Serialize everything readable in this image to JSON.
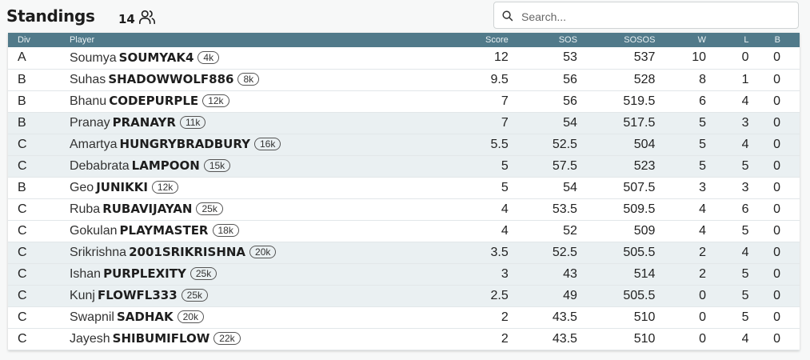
{
  "header": {
    "title": "Standings",
    "participant_count": "14",
    "people_icon": "people-icon"
  },
  "search": {
    "placeholder": "Search...",
    "icon": "search-icon"
  },
  "table": {
    "columns": {
      "div": "Div",
      "player": "Player",
      "score": "Score",
      "sos": "SOS",
      "sosos": "SOSOS",
      "w": "W",
      "l": "L",
      "b": "B"
    },
    "rows": [
      {
        "div": "A",
        "name": "Soumya",
        "handle": "SOUMYAK4",
        "rank": "4k",
        "score": "12",
        "sos": "53",
        "sosos": "537",
        "w": "10",
        "l": "0",
        "b": "0",
        "shaded": false
      },
      {
        "div": "B",
        "name": "Suhas",
        "handle": "SHADOWWOLF886",
        "rank": "8k",
        "score": "9.5",
        "sos": "56",
        "sosos": "528",
        "w": "8",
        "l": "1",
        "b": "0",
        "shaded": false
      },
      {
        "div": "B",
        "name": "Bhanu",
        "handle": "CODEPURPLE",
        "rank": "12k",
        "score": "7",
        "sos": "56",
        "sosos": "519.5",
        "w": "6",
        "l": "4",
        "b": "0",
        "shaded": false
      },
      {
        "div": "B",
        "name": "Pranay",
        "handle": "PRANAYR",
        "rank": "11k",
        "score": "7",
        "sos": "54",
        "sosos": "517.5",
        "w": "5",
        "l": "3",
        "b": "0",
        "shaded": true
      },
      {
        "div": "C",
        "name": "Amartya",
        "handle": "HUNGRYBRADBURY",
        "rank": "16k",
        "score": "5.5",
        "sos": "52.5",
        "sosos": "504",
        "w": "5",
        "l": "4",
        "b": "0",
        "shaded": true
      },
      {
        "div": "C",
        "name": "Debabrata",
        "handle": "LAMPOON",
        "rank": "15k",
        "score": "5",
        "sos": "57.5",
        "sosos": "523",
        "w": "5",
        "l": "5",
        "b": "0",
        "shaded": true
      },
      {
        "div": "B",
        "name": "Geo",
        "handle": "JUNIKKI",
        "rank": "12k",
        "score": "5",
        "sos": "54",
        "sosos": "507.5",
        "w": "3",
        "l": "3",
        "b": "0",
        "shaded": false
      },
      {
        "div": "C",
        "name": "Ruba",
        "handle": "RUBAVIJAYAN",
        "rank": "25k",
        "score": "4",
        "sos": "53.5",
        "sosos": "509.5",
        "w": "4",
        "l": "6",
        "b": "0",
        "shaded": false
      },
      {
        "div": "C",
        "name": "Gokulan",
        "handle": "PLAYMASTER",
        "rank": "18k",
        "score": "4",
        "sos": "52",
        "sosos": "509",
        "w": "4",
        "l": "5",
        "b": "0",
        "shaded": false
      },
      {
        "div": "C",
        "name": "Srikrishna",
        "handle": "2001SRIKRISHNA",
        "rank": "20k",
        "score": "3.5",
        "sos": "52.5",
        "sosos": "505.5",
        "w": "2",
        "l": "4",
        "b": "0",
        "shaded": true
      },
      {
        "div": "C",
        "name": "Ishan",
        "handle": "PURPLEXITY",
        "rank": "25k",
        "score": "3",
        "sos": "43",
        "sosos": "514",
        "w": "2",
        "l": "5",
        "b": "0",
        "shaded": true
      },
      {
        "div": "C",
        "name": "Kunj",
        "handle": "FLOWFL333",
        "rank": "25k",
        "score": "2.5",
        "sos": "49",
        "sosos": "505.5",
        "w": "0",
        "l": "5",
        "b": "0",
        "shaded": true
      },
      {
        "div": "C",
        "name": "Swapnil",
        "handle": "SADHAK",
        "rank": "20k",
        "score": "2",
        "sos": "43.5",
        "sosos": "510",
        "w": "0",
        "l": "5",
        "b": "0",
        "shaded": false
      },
      {
        "div": "C",
        "name": "Jayesh",
        "handle": "SHIBUMIFLOW",
        "rank": "22k",
        "score": "2",
        "sos": "43.5",
        "sosos": "510",
        "w": "0",
        "l": "4",
        "b": "0",
        "shaded": false
      }
    ]
  }
}
